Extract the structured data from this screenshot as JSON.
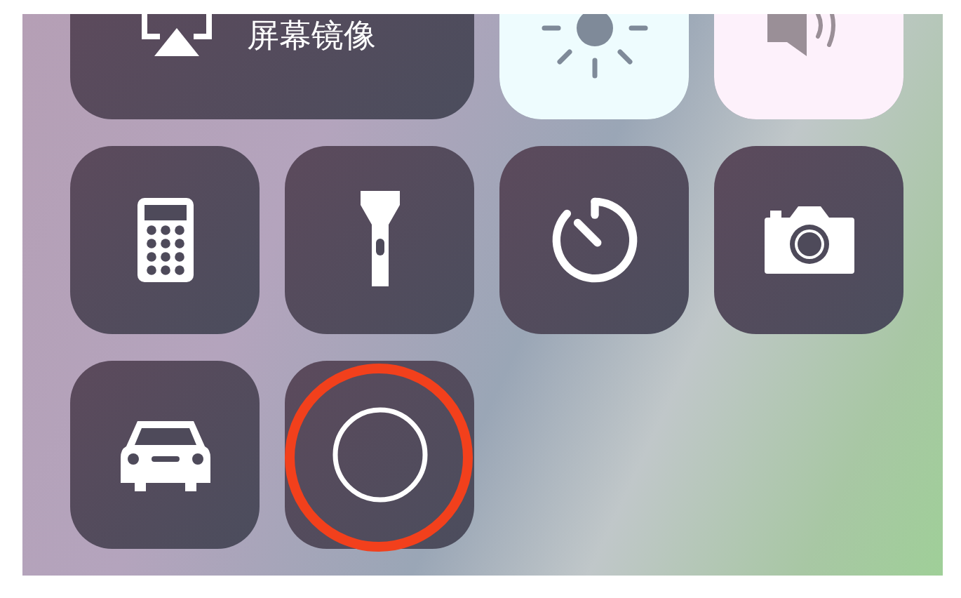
{
  "control_center": {
    "tiles": [
      {
        "kind": "mirroring",
        "label": "屏幕镜像"
      },
      {
        "kind": "brightness",
        "level": 1
      },
      {
        "kind": "volume",
        "level": 1
      },
      {
        "kind": "calculator"
      },
      {
        "kind": "flashlight"
      },
      {
        "kind": "timer"
      },
      {
        "kind": "camera"
      },
      {
        "kind": "car"
      },
      {
        "kind": "record",
        "annotated": true
      }
    ]
  }
}
